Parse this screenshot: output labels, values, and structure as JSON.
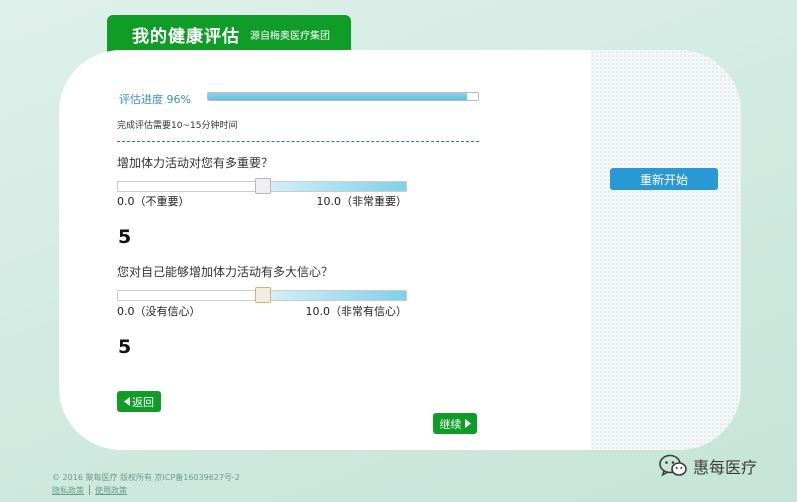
{
  "header": {
    "title": "我的健康评估",
    "subtitle": "源自梅奥医疗集团"
  },
  "progress": {
    "label": "评估进度 96%",
    "percent": 96,
    "note": "完成评估需要10~15分钟时间"
  },
  "questions": [
    {
      "text": "增加体力活动对您有多重要？",
      "min_label": "0.0（不重要）",
      "max_label": "10.0（非常重要）",
      "value": "5",
      "slider_value": 5,
      "slider_max": 10
    },
    {
      "text": "您对自己能够增加体力活动有多大信心？",
      "min_label": "0.0（没有信心）",
      "max_label": "10.0（非常有信心）",
      "value": "5",
      "slider_value": 5,
      "slider_max": 10
    }
  ],
  "buttons": {
    "back": "返回",
    "next": "继续",
    "restart": "重新开始"
  },
  "footer": {
    "copyright": "© 2016 ​聚​每​医​疗 ​版​权​所​有 ​京​ICP​备​16039627​号​-2",
    "privacy": "隐私政策",
    "terms": "使用政策"
  },
  "watermark": {
    "text": "惠每医疗",
    "icon": "wechat-icon"
  },
  "colors": {
    "brand_green": "#0f9d27",
    "accent_blue": "#2a98d3",
    "progress_blue": "#5fc0e2"
  }
}
